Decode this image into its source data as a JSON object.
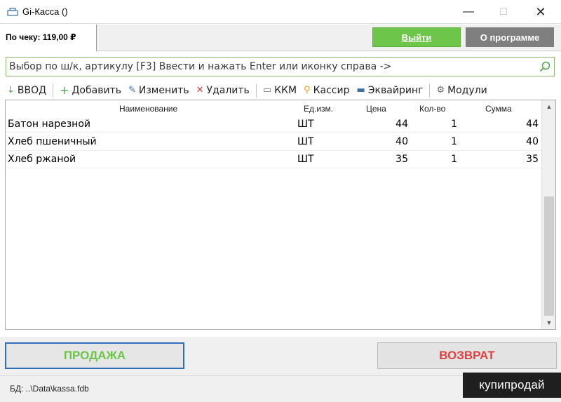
{
  "window": {
    "title": "Gi-Касса ()",
    "minimize": "—",
    "maximize": "☐",
    "close": "✕"
  },
  "header": {
    "receipt_total": "По чеку: 119,00 ₽",
    "exit_label": "Выйти",
    "about_label": "О программе"
  },
  "search": {
    "placeholder": "Выбор по ш/к, артикулу [F3] Ввести и нажать Enter или иконку справа ->",
    "value": ""
  },
  "toolbar": {
    "input_label": "ВВОД",
    "add_label": "Добавить",
    "edit_label": "Изменить",
    "delete_label": "Удалить",
    "kkm_label": "ККМ",
    "cashier_label": "Кассир",
    "acquiring_label": "Эквайринг",
    "modules_label": "Модули"
  },
  "table": {
    "columns": {
      "name": "Наименование",
      "unit": "Ед.изм.",
      "price": "Цена",
      "qty": "Кол-во",
      "sum": "Сумма"
    },
    "rows": [
      {
        "name": "Батон нарезной",
        "unit": "ШТ",
        "price": "44",
        "qty": "1",
        "sum": "44"
      },
      {
        "name": "Хлеб пшеничный",
        "unit": "ШТ",
        "price": "40",
        "qty": "1",
        "sum": "40"
      },
      {
        "name": "Хлеб ржаной",
        "unit": "ШТ",
        "price": "35",
        "qty": "1",
        "sum": "35"
      }
    ]
  },
  "buttons": {
    "sale_label": "ПРОДАЖА",
    "return_label": "ВОЗВРАТ"
  },
  "status": {
    "db_path": "БД: ..\\Data\\kassa.fdb"
  },
  "watermark": {
    "text": "купипродай"
  },
  "colors": {
    "exit_green": "#6dc64a",
    "about_gray": "#7f7f7f",
    "sale_green": "#6dc64a",
    "return_red": "#e04040",
    "sale_border_blue": "#2e6fb5"
  }
}
